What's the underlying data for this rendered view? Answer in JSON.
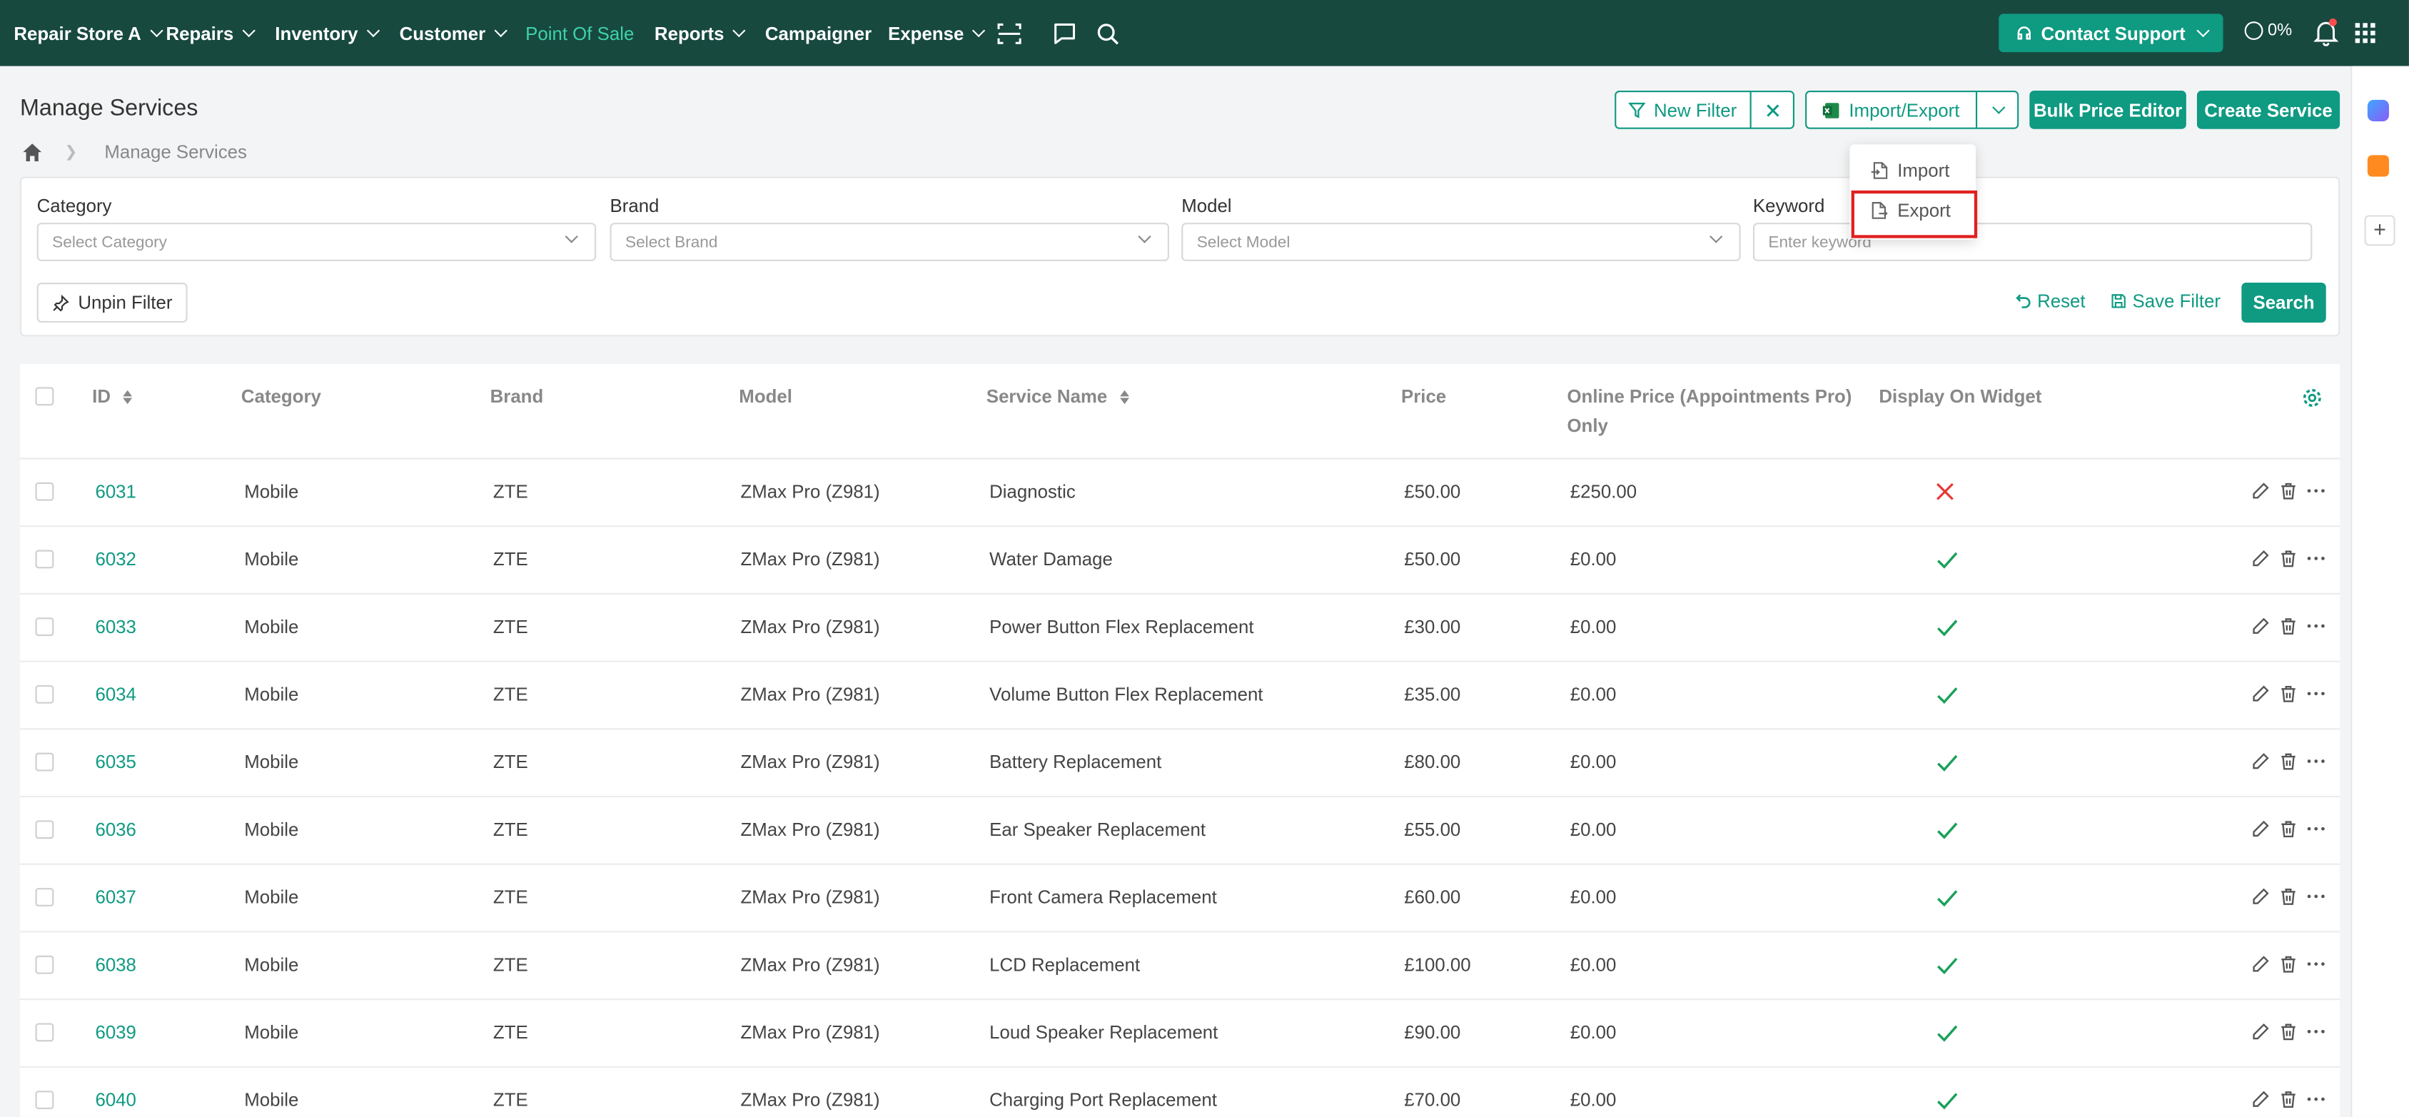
{
  "nav": {
    "store": "Repair Store A",
    "items": [
      "Repairs",
      "Inventory",
      "Customer",
      "Point Of Sale",
      "Reports",
      "Campaigner",
      "Expense"
    ],
    "contact_support": "Contact Support",
    "progress": "0%"
  },
  "page": {
    "title": "Manage Services",
    "breadcrumb": "Manage Services"
  },
  "toolbar": {
    "new_filter": "New Filter",
    "import_export": "Import/Export",
    "bulk_price_editor": "Bulk Price Editor",
    "create_service": "Create Service"
  },
  "dropdown": {
    "import": "Import",
    "export": "Export"
  },
  "filters": {
    "category_label": "Category",
    "category_placeholder": "Select Category",
    "brand_label": "Brand",
    "brand_placeholder": "Select Brand",
    "model_label": "Model",
    "model_placeholder": "Select Model",
    "keyword_label": "Keyword",
    "keyword_placeholder": "Enter keyword",
    "unpin": "Unpin Filter",
    "reset": "Reset",
    "save_filter": "Save Filter",
    "search": "Search"
  },
  "table": {
    "headers": {
      "id": "ID",
      "category": "Category",
      "brand": "Brand",
      "model": "Model",
      "service_name": "Service Name",
      "price": "Price",
      "online_price_1": "Online Price (Appointments Pro)",
      "online_price_2": "Only",
      "display_on_widget": "Display On Widget"
    },
    "rows": [
      {
        "id": "6031",
        "category": "Mobile",
        "brand": "ZTE",
        "model": "ZMax Pro (Z981)",
        "service": "Diagnostic",
        "price": "£50.00",
        "online": "£250.00",
        "widget": false
      },
      {
        "id": "6032",
        "category": "Mobile",
        "brand": "ZTE",
        "model": "ZMax Pro (Z981)",
        "service": "Water Damage",
        "price": "£50.00",
        "online": "£0.00",
        "widget": true
      },
      {
        "id": "6033",
        "category": "Mobile",
        "brand": "ZTE",
        "model": "ZMax Pro (Z981)",
        "service": "Power Button Flex Replacement",
        "price": "£30.00",
        "online": "£0.00",
        "widget": true
      },
      {
        "id": "6034",
        "category": "Mobile",
        "brand": "ZTE",
        "model": "ZMax Pro (Z981)",
        "service": "Volume Button Flex Replacement",
        "price": "£35.00",
        "online": "£0.00",
        "widget": true
      },
      {
        "id": "6035",
        "category": "Mobile",
        "brand": "ZTE",
        "model": "ZMax Pro (Z981)",
        "service": "Battery Replacement",
        "price": "£80.00",
        "online": "£0.00",
        "widget": true
      },
      {
        "id": "6036",
        "category": "Mobile",
        "brand": "ZTE",
        "model": "ZMax Pro (Z981)",
        "service": "Ear Speaker Replacement",
        "price": "£55.00",
        "online": "£0.00",
        "widget": true
      },
      {
        "id": "6037",
        "category": "Mobile",
        "brand": "ZTE",
        "model": "ZMax Pro (Z981)",
        "service": "Front Camera Replacement",
        "price": "£60.00",
        "online": "£0.00",
        "widget": true
      },
      {
        "id": "6038",
        "category": "Mobile",
        "brand": "ZTE",
        "model": "ZMax Pro (Z981)",
        "service": "LCD Replacement",
        "price": "£100.00",
        "online": "£0.00",
        "widget": true
      },
      {
        "id": "6039",
        "category": "Mobile",
        "brand": "ZTE",
        "model": "ZMax Pro (Z981)",
        "service": "Loud Speaker Replacement",
        "price": "£90.00",
        "online": "£0.00",
        "widget": true
      },
      {
        "id": "6040",
        "category": "Mobile",
        "brand": "ZTE",
        "model": "ZMax Pro (Z981)",
        "service": "Charging Port Replacement",
        "price": "£70.00",
        "online": "£0.00",
        "widget": true
      }
    ]
  },
  "colors": {
    "nav_bg": "#17493f",
    "accent": "#0f9a82",
    "active_nav": "#3fd2a7",
    "check": "#1aa05a",
    "cross": "#e53935",
    "highlight_box": "#e02020"
  }
}
